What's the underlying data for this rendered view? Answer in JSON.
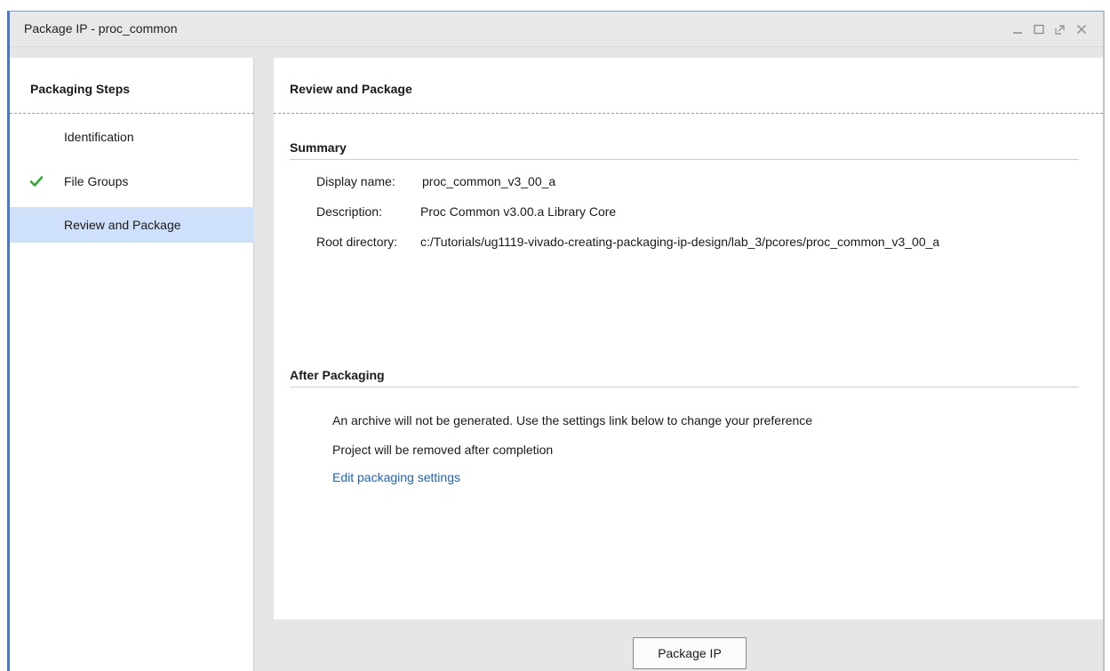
{
  "window": {
    "title": "Package IP - proc_common"
  },
  "steps_panel": {
    "header": "Packaging Steps",
    "items": [
      {
        "label": "Identification",
        "completed": false,
        "selected": false
      },
      {
        "label": "File Groups",
        "completed": true,
        "selected": false
      },
      {
        "label": "Review and Package",
        "completed": false,
        "selected": true
      }
    ]
  },
  "main": {
    "header": "Review and Package",
    "summary": {
      "title": "Summary",
      "display_name_label": "Display name:",
      "display_name_value": "proc_common_v3_00_a",
      "description_label": "Description:",
      "description_value": "Proc Common v3.00.a Library Core",
      "root_dir_label": "Root directory:",
      "root_dir_value": "c:/Tutorials/ug1119-vivado-creating-packaging-ip-design/lab_3/pcores/proc_common_v3_00_a"
    },
    "after": {
      "title": "After Packaging",
      "line1": "An archive will not be generated. Use the settings link below to change your preference",
      "line2": "Project will be removed after completion",
      "settings_link": "Edit packaging settings"
    },
    "footer": {
      "package_button": "Package IP"
    }
  },
  "colors": {
    "selected_row": "#cfe0fb",
    "checkmark": "#2eaa2e",
    "link": "#1c62d4",
    "window_accent": "#4a78c8"
  }
}
